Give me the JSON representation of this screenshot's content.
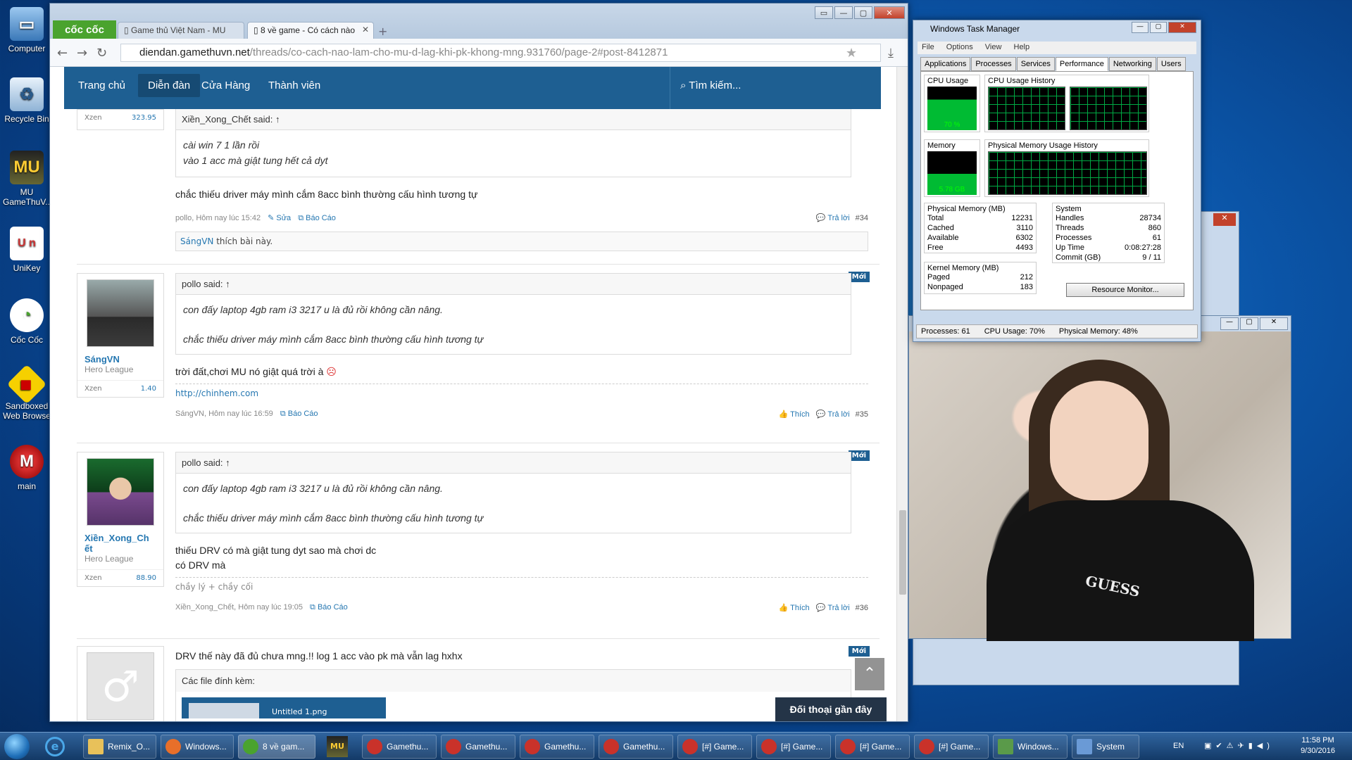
{
  "desktop_icons": [
    {
      "label": "Computer"
    },
    {
      "label": "Recycle Bin"
    },
    {
      "label": "MU GameThuV..."
    },
    {
      "label": "UniKey"
    },
    {
      "label": "Cốc Cốc"
    },
    {
      "label": "Sandboxed Web Browse"
    },
    {
      "label": "main"
    }
  ],
  "browser": {
    "logo": "cốc cốc",
    "tabs": [
      {
        "label": "Game thủ Việt Nam - MU"
      },
      {
        "label": "8 về game - Có cách nào"
      }
    ],
    "url_domain": "diendan.gamethuvn.net",
    "url_path": "/threads/co-cach-nao-lam-cho-mu-d-lag-khi-pk-khong-mng.931760/page-2#post-8412871",
    "nav": {
      "home": "Trang chủ",
      "forum": "Diễn đàn",
      "store": "Cửa Hàng",
      "members": "Thành viên",
      "search": "Tìm kiếm..."
    }
  },
  "posts": [
    {
      "user_xzen_label": "Xzen",
      "user_xzen": "323.95",
      "quote_author": "Xiền_Xong_Chết said: ↑",
      "quote_lines": [
        "cài win 7 1 lần rồi",
        "vào 1 acc mà giật tung hết cả dyt"
      ],
      "message": "chắc thiếu driver máy mình cắm 8acc bình thường cấu hình tương tự",
      "meta_left": "pollo, Hôm nay lúc 15:42",
      "edit": "Sửa",
      "report": "Báo Cáo",
      "reply": "Trả lời",
      "num": "#34",
      "likes_user": "SángVN",
      "likes_text": " thích bài này."
    },
    {
      "badge": "Mới",
      "username": "SángVN",
      "title": "Hero League",
      "xzen_label": "Xzen",
      "xzen": "1.40",
      "quote_author": "pollo said: ↑",
      "quote_lines": [
        "con đấy laptop 4gb ram i3 3217 u là đủ rồi không cần nâng.",
        "chắc thiếu driver máy mình cắm 8acc bình thường cấu hình tương tự"
      ],
      "message": "trời đất,chơi MU nó giật quá trời à",
      "signature": "http://chinhem.com",
      "meta_left": "SángVN, Hôm nay lúc 16:59",
      "report": "Báo Cáo",
      "like": "Thích",
      "reply": "Trả lời",
      "num": "#35"
    },
    {
      "badge": "Mới",
      "username": "Xiền_Xong_Ch ết",
      "title": "Hero League",
      "xzen_label": "Xzen",
      "xzen": "88.90",
      "quote_author": "pollo said: ↑",
      "quote_lines": [
        "con đấy laptop 4gb ram i3 3217 u là đủ rồi không cần nâng.",
        "chắc thiếu driver máy mình cắm 8acc bình thường cấu hình tương tự"
      ],
      "message_lines": [
        "thiếu DRV có mà giật tung dyt sao mà chơi dc",
        "có DRV mà"
      ],
      "signature": "chầy lý + chầy cối",
      "meta_left": "Xiền_Xong_Chết, Hôm nay lúc 19:05",
      "report": "Báo Cáo",
      "like": "Thích",
      "reply": "Trả lời",
      "num": "#36"
    },
    {
      "badge": "Mới",
      "message": "DRV thế này đã đủ chưa mng.!! log 1 acc vào pk mà vẫn lag hxhx",
      "attach_header": "Các file đính kèm:",
      "attach_file": "Untitled 1.png"
    }
  ],
  "chat_button": "Đối thoại gần đây",
  "task_manager": {
    "title": "Windows Task Manager",
    "menu": [
      "File",
      "Options",
      "View",
      "Help"
    ],
    "tabs": [
      "Applications",
      "Processes",
      "Services",
      "Performance",
      "Networking",
      "Users"
    ],
    "cpu_usage_label": "CPU Usage",
    "cpu_usage": "70 %",
    "cpu_history_label": "CPU Usage History",
    "memory_label": "Memory",
    "memory": "5.78 GB",
    "mem_history_label": "Physical Memory Usage History",
    "physmem_header": "Physical Memory (MB)",
    "physmem": [
      [
        "Total",
        "12231"
      ],
      [
        "Cached",
        "3110"
      ],
      [
        "Available",
        "6302"
      ],
      [
        "Free",
        "4493"
      ]
    ],
    "system_header": "System",
    "system": [
      [
        "Handles",
        "28734"
      ],
      [
        "Threads",
        "860"
      ],
      [
        "Processes",
        "61"
      ],
      [
        "Up Time",
        "0:08:27:28"
      ],
      [
        "Commit (GB)",
        "9 / 11"
      ]
    ],
    "kernel_header": "Kernel Memory (MB)",
    "kernel": [
      [
        "Paged",
        "212"
      ],
      [
        "Nonpaged",
        "183"
      ]
    ],
    "resource_monitor": "Resource Monitor...",
    "status": [
      "Processes: 61",
      "CPU Usage: 70%",
      "Physical Memory: 48%"
    ]
  },
  "video": {
    "shirt_text": "GUESS"
  },
  "taskbar": {
    "items": [
      {
        "label": "Remix_O..."
      },
      {
        "label": "Windows..."
      },
      {
        "label": "8 về gam..."
      },
      {
        "label": "Gamethu..."
      },
      {
        "label": "Gamethu..."
      },
      {
        "label": "Gamethu..."
      },
      {
        "label": "Gamethu..."
      },
      {
        "label": "[#] Game..."
      },
      {
        "label": "[#] Game..."
      },
      {
        "label": "[#] Game..."
      },
      {
        "label": "[#] Game..."
      },
      {
        "label": "Windows..."
      },
      {
        "label": "System"
      }
    ],
    "lang": "EN",
    "time": "11:58 PM",
    "date": "9/30/2016"
  }
}
